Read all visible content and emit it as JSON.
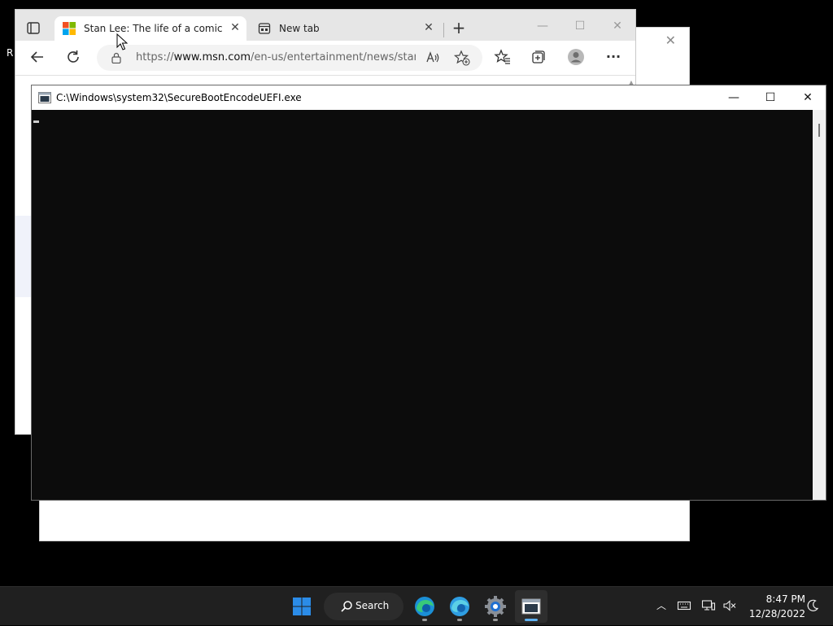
{
  "desktop": {
    "partial_label": "R"
  },
  "browser": {
    "tabs": [
      {
        "title": "Stan Lee: The life of a comic book",
        "active": true,
        "favicon": "microsoft-logo-icon"
      },
      {
        "title": "New tab",
        "active": false,
        "favicon": "new-tab-page-icon"
      }
    ],
    "address": {
      "prefix": "https://",
      "host": "www.msn.com",
      "path": "/en-us/entertainment/news/stan..."
    }
  },
  "console": {
    "title": "C:\\Windows\\system32\\SecureBootEncodeUEFI.exe"
  },
  "taskbar": {
    "search_label": "Search",
    "apps": [
      "start-icon",
      "edge-icon",
      "edge-beta-icon",
      "settings-icon",
      "console-app-icon"
    ],
    "clock": {
      "time": "8:47 PM",
      "date": "12/28/2022"
    }
  },
  "colors": {
    "console_bg": "#0c0c0c",
    "taskbar_bg": "#202020",
    "accent": "#5fb2f2",
    "start_blue": "#0f6cbd"
  }
}
